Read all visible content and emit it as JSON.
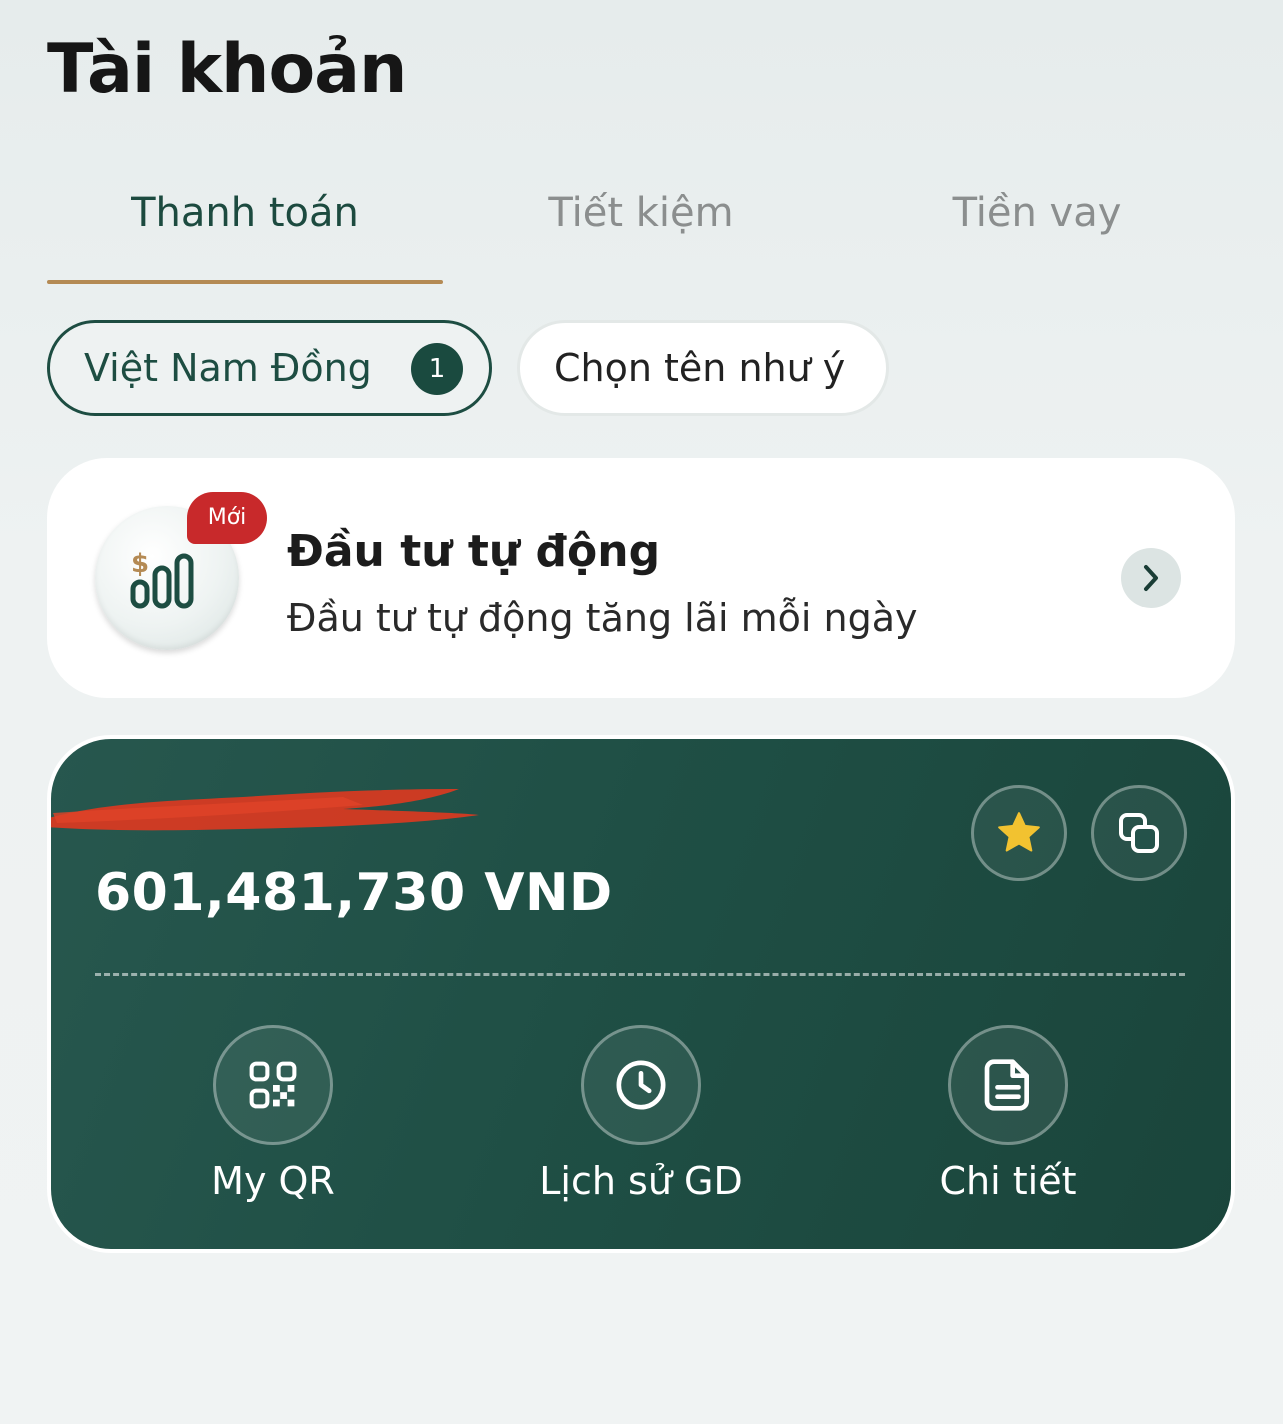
{
  "header": {
    "title": "Tài khoản"
  },
  "tabs": [
    {
      "label": "Thanh toán",
      "active": true
    },
    {
      "label": "Tiết kiệm",
      "active": false
    },
    {
      "label": "Tiền vay",
      "active": false
    }
  ],
  "chips": {
    "vnd": {
      "label": "Việt Nam Đồng",
      "count": "1"
    },
    "custom_name": {
      "label": "Chọn tên như ý"
    }
  },
  "promo": {
    "badge": "Mới",
    "title": "Đầu tư tự động",
    "subtitle": "Đầu tư tự động tăng lãi mỗi ngày"
  },
  "account": {
    "balance": "601,481,730 VND",
    "actions": [
      {
        "label": "My QR",
        "icon": "qr-code-icon"
      },
      {
        "label": "Lịch sử GD",
        "icon": "clock-icon"
      },
      {
        "label": "Chi tiết",
        "icon": "document-icon"
      }
    ]
  },
  "colors": {
    "accent_dark_green": "#1d4d42",
    "tab_underline": "#b48a54",
    "badge_red": "#c8292b",
    "star_yellow": "#f2c230"
  }
}
